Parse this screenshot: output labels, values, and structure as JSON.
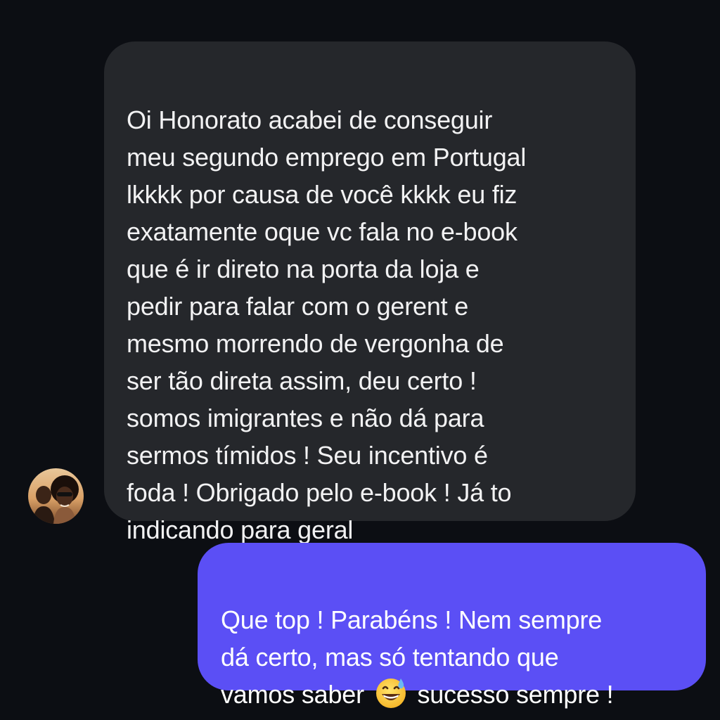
{
  "conversation": {
    "incoming_message": {
      "text": "Oi Honorato acabei de conseguir\nmeu segundo emprego em Portugal\nlkkkk por causa de você kkkk eu fiz\nexatamente oque vc fala no e-book\nque é ir direto na porta da loja e\npedir para falar com o gerent e\nmesmo morrendo de vergonha  de\nser tão direta assim, deu certo !\nsomos imigrantes e não dá para\nsermos tímidos ! Seu incentivo é\nfoda ! Obrigado pelo e-book ! Já to\nindicando para geral",
      "bubble_color": "#25272b",
      "avatar_icon": "user-avatar-couple-photo"
    },
    "outgoing_message": {
      "text_before_emoji": "Que top ! Parabéns ! Nem sempre\ndá certo, mas só tentando que\nvamos saber ",
      "emoji": "grinning-face-with-sweat-emoji",
      "text_after_emoji": " sucesso sempre !",
      "bubble_color": "#5b4ff5"
    },
    "background_color": "#0c0e13"
  }
}
